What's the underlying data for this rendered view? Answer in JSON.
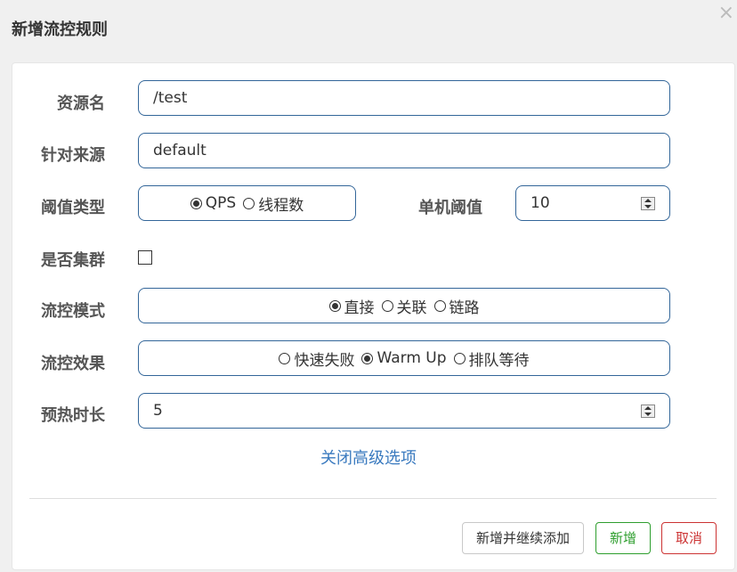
{
  "dialog": {
    "title": "新增流控规则",
    "close_label": "×"
  },
  "form": {
    "resource": {
      "label": "资源名",
      "value": "/test"
    },
    "limit_app": {
      "label": "针对来源",
      "value": "default"
    },
    "grade": {
      "label": "阈值类型",
      "options": [
        "QPS",
        "线程数"
      ],
      "selected": "QPS"
    },
    "count": {
      "label": "单机阈值",
      "value": "10"
    },
    "cluster": {
      "label": "是否集群",
      "checked": false
    },
    "strategy": {
      "label": "流控模式",
      "options": [
        "直接",
        "关联",
        "链路"
      ],
      "selected": "直接"
    },
    "control_behavior": {
      "label": "流控效果",
      "options": [
        "快速失败",
        "Warm Up",
        "排队等待"
      ],
      "selected": "Warm Up"
    },
    "warm_up_period": {
      "label": "预热时长",
      "value": "5"
    }
  },
  "advanced_toggle": "关闭高级选项",
  "buttons": {
    "save_and_continue": "新增并继续添加",
    "save": "新增",
    "cancel": "取消"
  }
}
